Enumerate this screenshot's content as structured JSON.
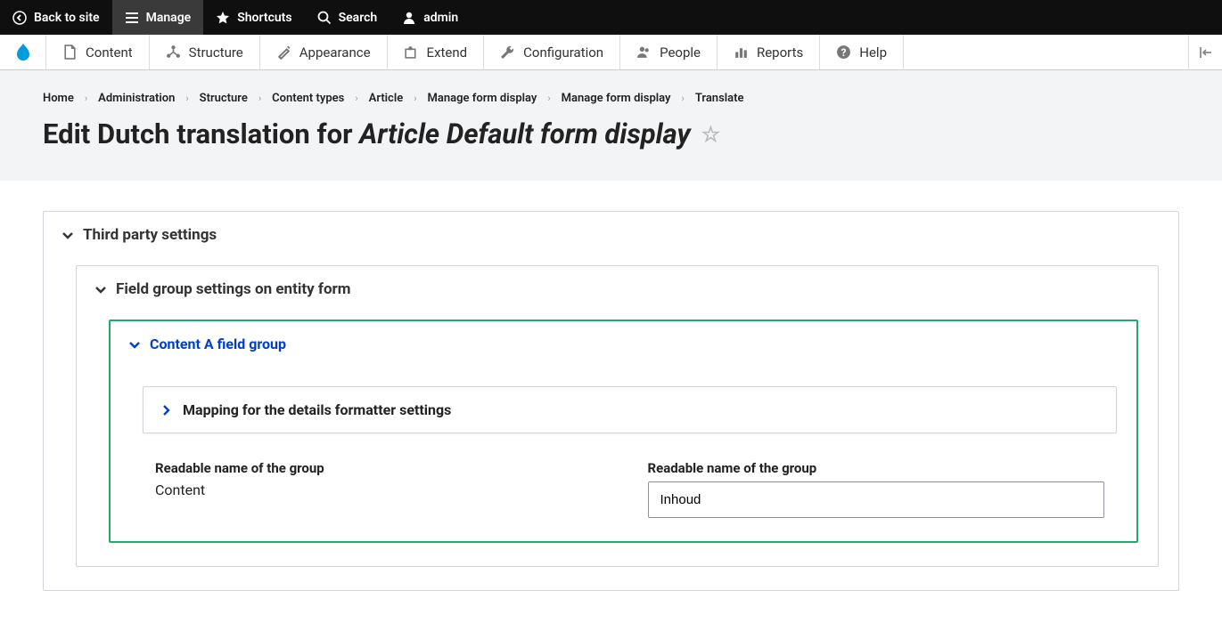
{
  "toolbar": {
    "back": "Back to site",
    "manage": "Manage",
    "shortcuts": "Shortcuts",
    "search": "Search",
    "user": "admin"
  },
  "adminMenu": {
    "content": "Content",
    "structure": "Structure",
    "appearance": "Appearance",
    "extend": "Extend",
    "configuration": "Configuration",
    "people": "People",
    "reports": "Reports",
    "help": "Help"
  },
  "breadcrumb": [
    "Home",
    "Administration",
    "Structure",
    "Content types",
    "Article",
    "Manage form display",
    "Manage form display",
    "Translate"
  ],
  "title": {
    "prefix": "Edit Dutch translation for ",
    "italic": "Article Default form display"
  },
  "panels": {
    "thirdParty": "Third party settings",
    "fieldGroup": "Field group settings on entity form",
    "contentA": "Content A field group",
    "mapping": "Mapping for the details formatter settings"
  },
  "fields": {
    "leftLabel": "Readable name of the group",
    "leftValue": "Content",
    "rightLabel": "Readable name of the group",
    "rightValue": "Inhoud"
  }
}
